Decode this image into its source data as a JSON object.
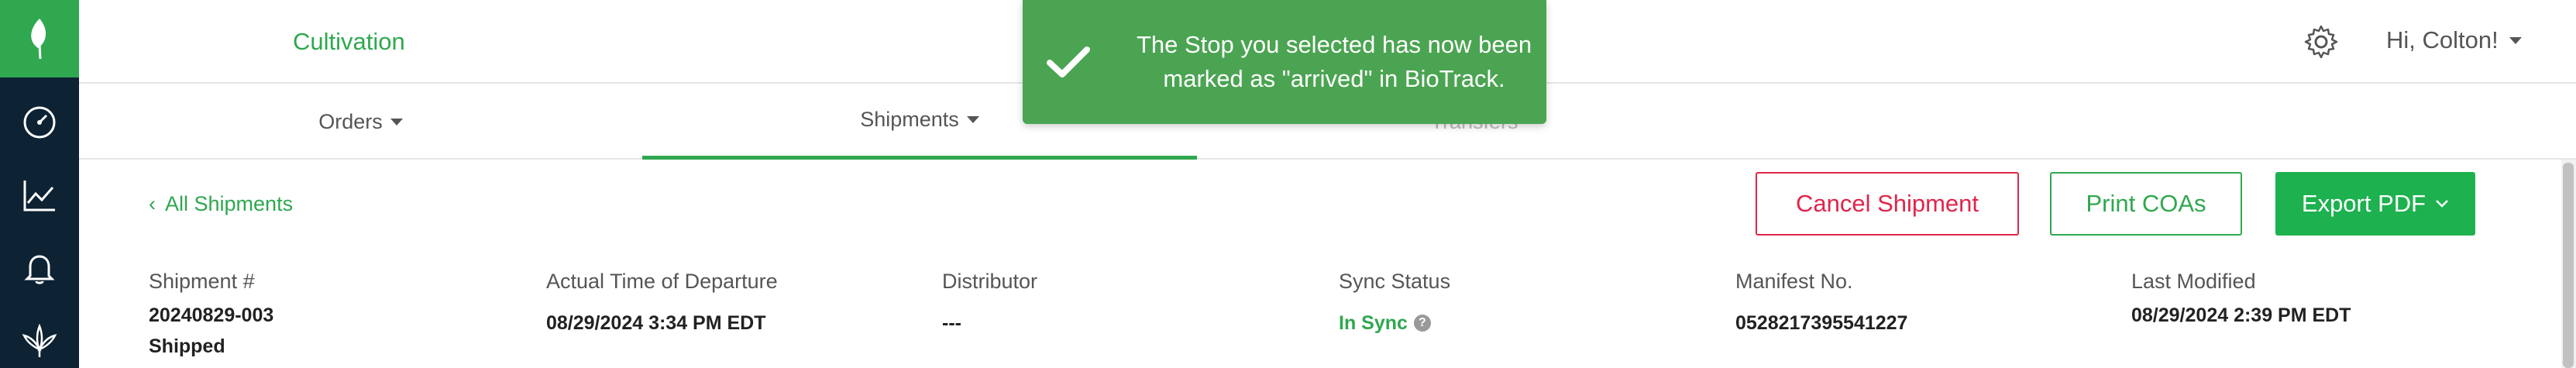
{
  "header": {
    "app_name": "Cultivation",
    "greeting": "Hi, Colton!"
  },
  "tabs": [
    {
      "label": "Orders"
    },
    {
      "label": "Shipments"
    },
    {
      "label": "Transfers"
    }
  ],
  "toast": {
    "message": "The Stop you selected has now been marked as \"arrived\" in BioTrack."
  },
  "actions": {
    "back_label": "All Shipments",
    "cancel_label": "Cancel Shipment",
    "print_label": "Print COAs",
    "export_label": "Export PDF"
  },
  "details": {
    "shipment_label": "Shipment #",
    "shipment_number": "20240829-003",
    "shipment_status": "Shipped",
    "departure_label": "Actual Time of Departure",
    "departure_value": "08/29/2024 3:34 PM EDT",
    "distributor_label": "Distributor",
    "distributor_value": "---",
    "sync_label": "Sync Status",
    "sync_value": "In Sync",
    "manifest_label": "Manifest No.",
    "manifest_value": "0528217395541227",
    "modified_label": "Last Modified",
    "modified_value": "08/29/2024 2:39 PM EDT"
  },
  "colors": {
    "brand_green": "#2fa84f",
    "rail_dark": "#0d2233",
    "danger": "#e0254b",
    "toast": "#4ba452"
  }
}
